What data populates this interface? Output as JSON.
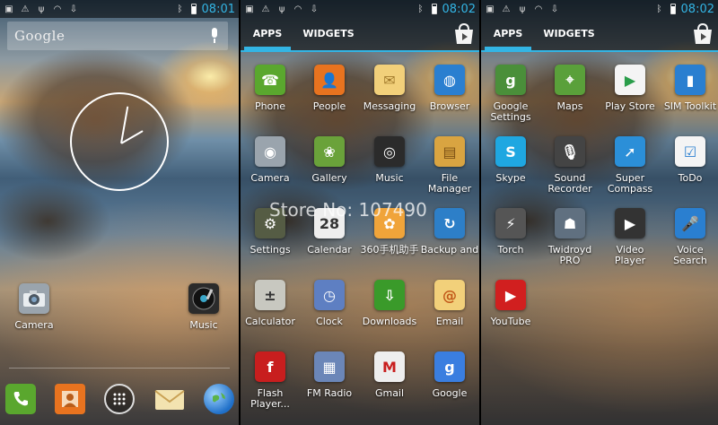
{
  "status": {
    "time": "08:01",
    "time2": "08:02",
    "time3": "08:02"
  },
  "home": {
    "search_logo": "Google",
    "shortcuts": [
      {
        "label": "Camera",
        "icon": "camera-icon"
      },
      {
        "label": "Music",
        "icon": "music-icon"
      }
    ],
    "dock": [
      {
        "icon": "phone-icon"
      },
      {
        "icon": "people-icon"
      },
      {
        "icon": "all-apps-icon"
      },
      {
        "icon": "messaging-icon"
      },
      {
        "icon": "browser-icon"
      }
    ]
  },
  "drawer": {
    "tabs": [
      "APPS",
      "WIDGETS"
    ],
    "page1": [
      {
        "label": "Phone",
        "icon": "phone-icon",
        "color": "#5aa72e"
      },
      {
        "label": "People",
        "icon": "people-icon",
        "color": "#e8731f"
      },
      {
        "label": "Messaging",
        "icon": "messaging-icon",
        "color": "#f2d07a"
      },
      {
        "label": "Browser",
        "icon": "browser-icon",
        "color": "#2a7fd0"
      },
      {
        "label": "Camera",
        "icon": "camera-icon",
        "color": "#9aa4ad"
      },
      {
        "label": "Gallery",
        "icon": "gallery-icon",
        "color": "#6aa23a"
      },
      {
        "label": "Music",
        "icon": "music-icon",
        "color": "#2b2b2b"
      },
      {
        "label": "File Manager",
        "icon": "file-manager-icon",
        "color": "#d9a441"
      },
      {
        "label": "Settings",
        "icon": "settings-icon",
        "color": "#555c44"
      },
      {
        "label": "Calendar",
        "icon": "calendar-icon",
        "color": "#eeeeee"
      },
      {
        "label": "360手机助手",
        "icon": "assistant-360-icon",
        "color": "#f0a43a"
      },
      {
        "label": "Backup and",
        "icon": "backup-icon",
        "color": "#2d7fc8"
      },
      {
        "label": "Calculator",
        "icon": "calculator-icon",
        "color": "#c8c8c0"
      },
      {
        "label": "Clock",
        "icon": "clock-icon",
        "color": "#5e7fc2"
      },
      {
        "label": "Downloads",
        "icon": "downloads-icon",
        "color": "#3a9a2a"
      },
      {
        "label": "Email",
        "icon": "email-icon",
        "color": "#f2d07a"
      },
      {
        "label": "Flash Player...",
        "icon": "flash-player-icon",
        "color": "#c81e1e"
      },
      {
        "label": "FM Radio",
        "icon": "fm-radio-icon",
        "color": "#6b86b8"
      },
      {
        "label": "Gmail",
        "icon": "gmail-icon",
        "color": "#eeeeee"
      },
      {
        "label": "Google",
        "icon": "google-search-icon",
        "color": "#3a7ee0"
      }
    ],
    "page2": [
      {
        "label": "Google Settings",
        "icon": "google-settings-icon",
        "color": "#4a8f3a"
      },
      {
        "label": "Maps",
        "icon": "maps-icon",
        "color": "#5aa03a"
      },
      {
        "label": "Play Store",
        "icon": "play-store-icon",
        "color": "#f4f4f4"
      },
      {
        "label": "SIM Toolkit",
        "icon": "sim-toolkit-icon",
        "color": "#2a7fd0"
      },
      {
        "label": "Skype",
        "icon": "skype-icon",
        "color": "#1fa7e1"
      },
      {
        "label": "Sound Recorder",
        "icon": "sound-recorder-icon",
        "color": "#444444"
      },
      {
        "label": "Super Compass",
        "icon": "compass-icon",
        "color": "#2b8fd8"
      },
      {
        "label": "ToDo",
        "icon": "todo-icon",
        "color": "#f4f4f4"
      },
      {
        "label": "Torch",
        "icon": "torch-icon",
        "color": "#555555"
      },
      {
        "label": "Twidroyd PRO",
        "icon": "twidroyd-icon",
        "color": "#607080"
      },
      {
        "label": "Video Player",
        "icon": "video-player-icon",
        "color": "#333333"
      },
      {
        "label": "Voice Search",
        "icon": "voice-search-icon",
        "color": "#2a7fd0"
      },
      {
        "label": "YouTube",
        "icon": "youtube-icon",
        "color": "#d11f1f"
      }
    ]
  },
  "watermark": "Store No: 107490"
}
